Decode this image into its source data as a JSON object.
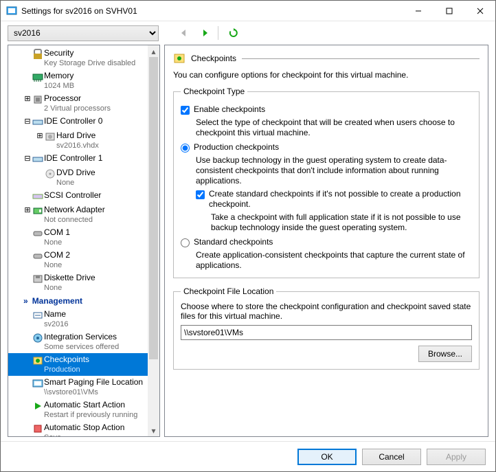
{
  "window": {
    "title": "Settings for sv2016 on SVHV01",
    "vm_select": "sv2016"
  },
  "tree": {
    "items": [
      {
        "icon": "security",
        "title": "Security",
        "sub": "Key Storage Drive disabled",
        "depth": 2,
        "exp": ""
      },
      {
        "icon": "memory",
        "title": "Memory",
        "sub": "1024 MB",
        "depth": 2,
        "exp": ""
      },
      {
        "icon": "cpu",
        "title": "Processor",
        "sub": "2 Virtual processors",
        "depth": 2,
        "exp": "plus"
      },
      {
        "icon": "ide",
        "title": "IDE Controller 0",
        "sub": "",
        "depth": 2,
        "exp": "minus"
      },
      {
        "icon": "hdd",
        "title": "Hard Drive",
        "sub": "sv2016.vhdx",
        "depth": 3,
        "exp": "plus"
      },
      {
        "icon": "ide",
        "title": "IDE Controller 1",
        "sub": "",
        "depth": 2,
        "exp": "minus"
      },
      {
        "icon": "dvd",
        "title": "DVD Drive",
        "sub": "None",
        "depth": 3,
        "exp": ""
      },
      {
        "icon": "scsi",
        "title": "SCSI Controller",
        "sub": "",
        "depth": 2,
        "exp": ""
      },
      {
        "icon": "nic",
        "title": "Network Adapter",
        "sub": "Not connected",
        "depth": 2,
        "exp": "plus"
      },
      {
        "icon": "com",
        "title": "COM 1",
        "sub": "None",
        "depth": 2,
        "exp": ""
      },
      {
        "icon": "com",
        "title": "COM 2",
        "sub": "None",
        "depth": 2,
        "exp": ""
      },
      {
        "icon": "fdd",
        "title": "Diskette Drive",
        "sub": "None",
        "depth": 2,
        "exp": ""
      }
    ],
    "management_header": "Management",
    "mgmt": [
      {
        "icon": "name",
        "title": "Name",
        "sub": "sv2016"
      },
      {
        "icon": "svc",
        "title": "Integration Services",
        "sub": "Some services offered"
      },
      {
        "icon": "chk",
        "title": "Checkpoints",
        "sub": "Production",
        "selected": true
      },
      {
        "icon": "page",
        "title": "Smart Paging File Location",
        "sub": "\\\\svstore01\\VMs"
      },
      {
        "icon": "start",
        "title": "Automatic Start Action",
        "sub": "Restart if previously running"
      },
      {
        "icon": "stop",
        "title": "Automatic Stop Action",
        "sub": "Save"
      }
    ]
  },
  "panel": {
    "header": "Checkpoints",
    "desc": "You can configure options for checkpoint for this virtual machine.",
    "type_legend": "Checkpoint Type",
    "enable_label": "Enable checkpoints",
    "enable_checked": true,
    "select_desc": "Select the type of checkpoint that will be created when users choose to checkpoint this virtual machine.",
    "prod_label": "Production checkpoints",
    "prod_desc": "Use backup technology in the guest operating system to create data-consistent checkpoints that don't include information about running applications.",
    "fallback_label": "Create standard checkpoints if it's not possible to create a production checkpoint.",
    "fallback_desc": "Take a checkpoint with full application state if it is not possible to use backup technology inside the guest operating system.",
    "std_label": "Standard checkpoints",
    "std_desc": "Create application-consistent checkpoints that capture the current state of applications.",
    "loc_legend": "Checkpoint File Location",
    "loc_desc": "Choose where to store the checkpoint configuration and checkpoint saved state files for this virtual machine.",
    "loc_value": "\\\\svstore01\\VMs",
    "browse": "Browse..."
  },
  "footer": {
    "ok": "OK",
    "cancel": "Cancel",
    "apply": "Apply"
  }
}
